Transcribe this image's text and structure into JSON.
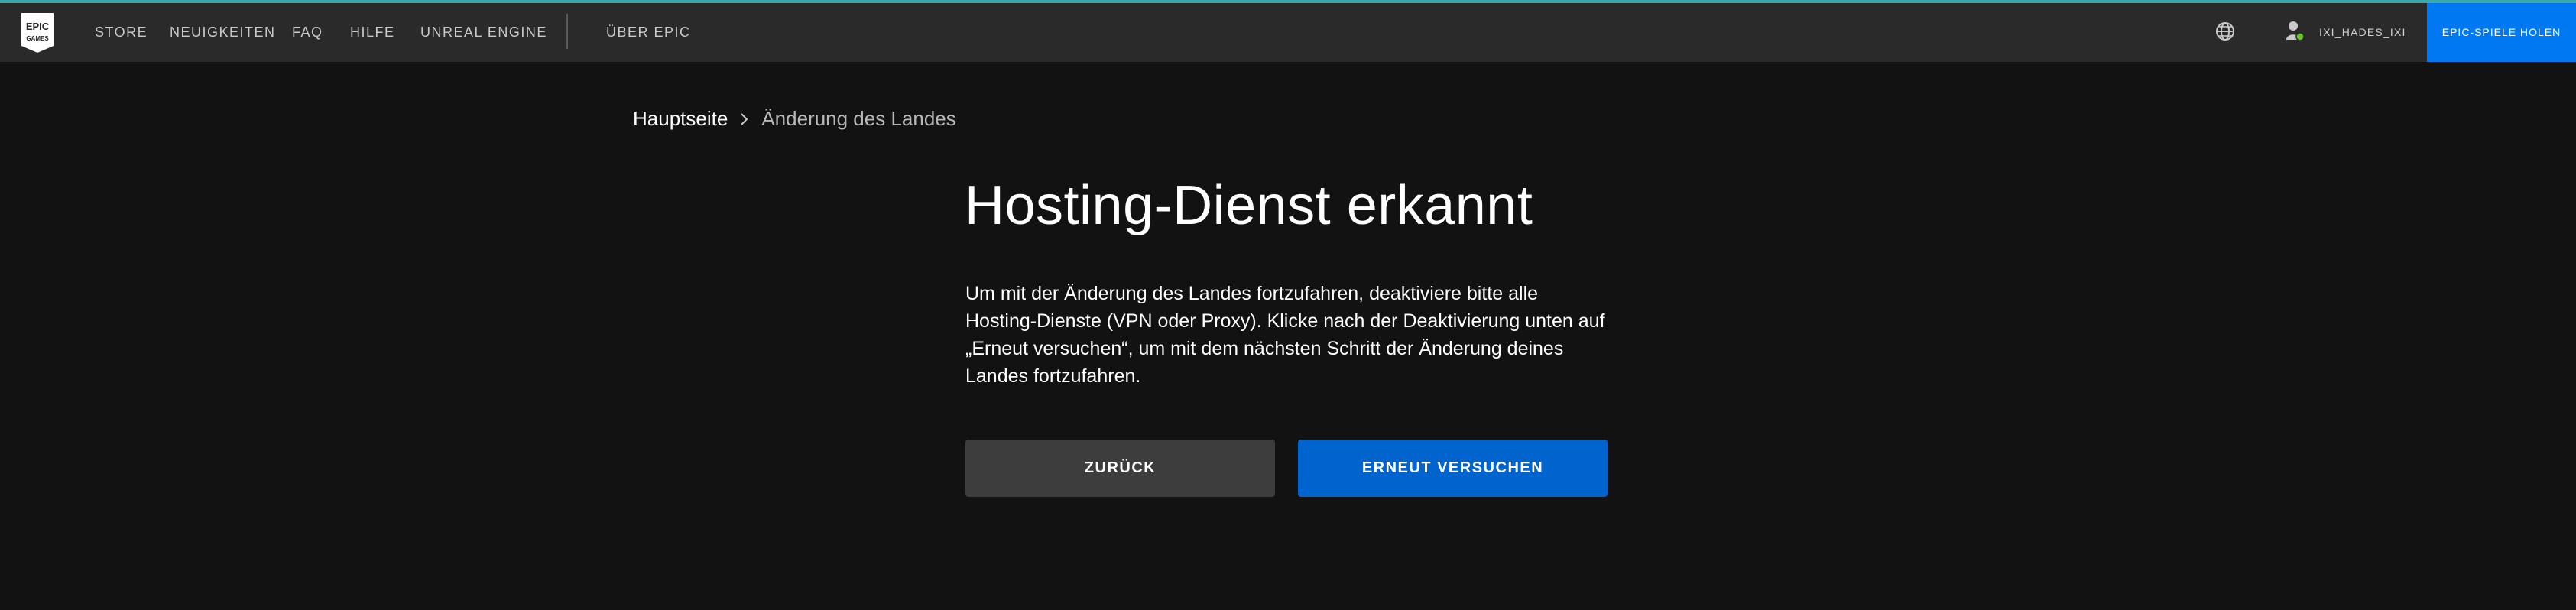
{
  "header": {
    "logo": {
      "line1": "EPIC",
      "line2": "GAMES"
    },
    "nav": [
      {
        "label": "STORE"
      },
      {
        "label": "NEUIGKEITEN"
      },
      {
        "label": "FAQ"
      },
      {
        "label": "HILFE"
      },
      {
        "label": "UNREAL ENGINE"
      },
      {
        "label": "ÜBER EPIC"
      }
    ],
    "user": {
      "name": "IXI_HADES_IXI",
      "status_color": "#6ac42b"
    },
    "cta_label": "EPIC-SPIELE HOLEN"
  },
  "breadcrumb": {
    "home": "Hauptseite",
    "current": "Änderung des Landes"
  },
  "main": {
    "title": "Hosting-Dienst erkannt",
    "description": "Um mit der Änderung des Landes fortzufahren, deaktiviere bitte alle Hosting-Dienste (VPN oder Proxy). Klicke nach der Deaktivierung unten auf „Erneut versuchen“, um mit dem nächsten Schritt der Änderung deines Landes fortzufahren.",
    "back_label": "ZURÜCK",
    "retry_label": "ERNEUT VERSUCHEN"
  },
  "colors": {
    "background": "#121212",
    "navbar": "#2a2a2a",
    "accent_line": "#3ba7a7",
    "primary": "#0064cf",
    "cta": "#0078f2",
    "secondary_button": "#3d3d3d"
  }
}
